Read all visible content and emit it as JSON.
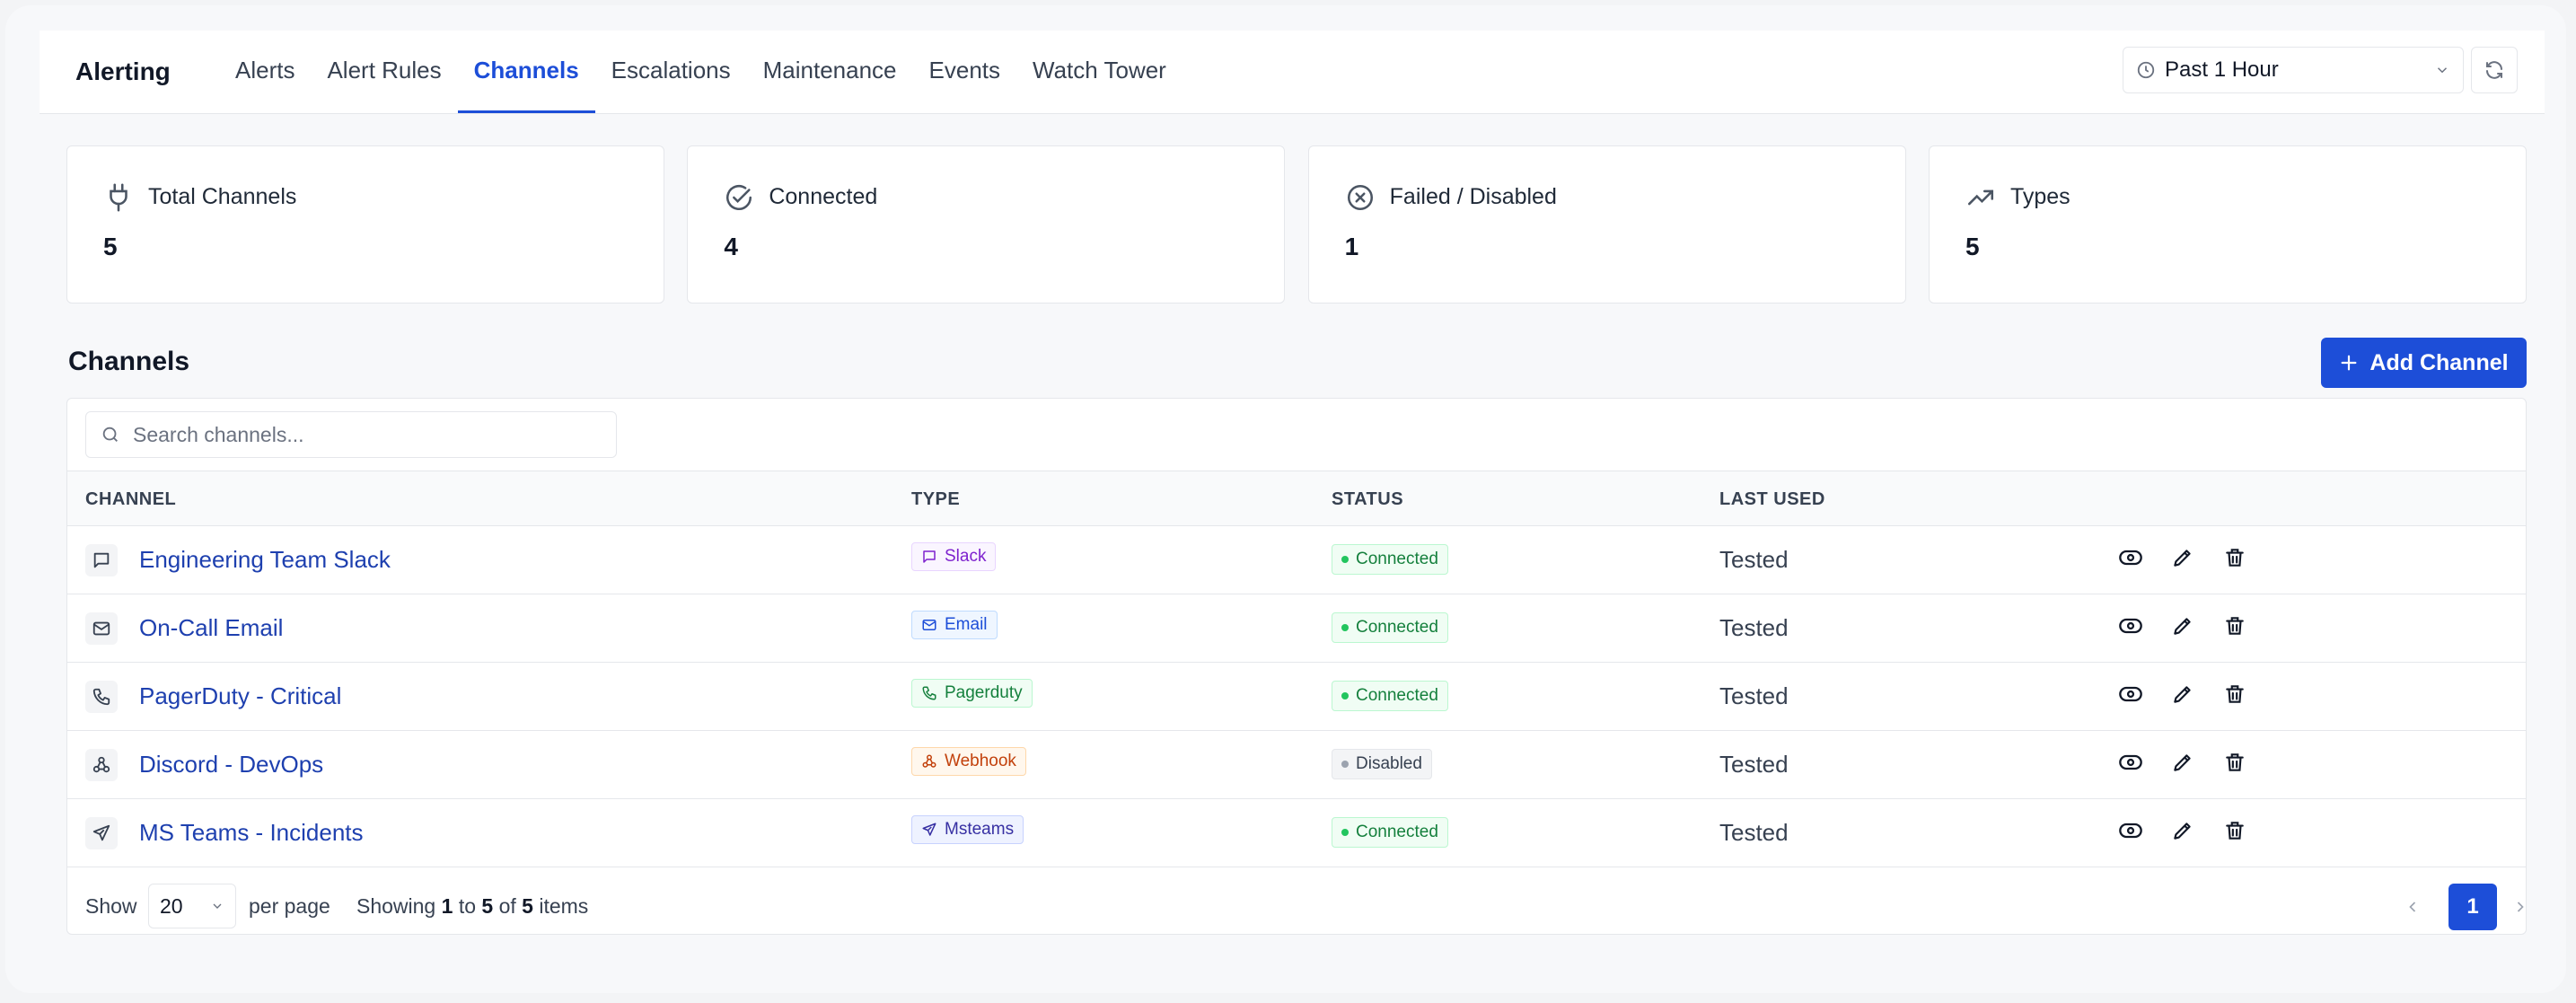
{
  "header": {
    "brand": "Alerting",
    "tabs": [
      {
        "label": "Alerts"
      },
      {
        "label": "Alert Rules"
      },
      {
        "label": "Channels",
        "active": true
      },
      {
        "label": "Escalations"
      },
      {
        "label": "Maintenance"
      },
      {
        "label": "Events"
      },
      {
        "label": "Watch Tower"
      }
    ],
    "time_range": "Past 1 Hour"
  },
  "stats": [
    {
      "label": "Total Channels",
      "value": "5",
      "icon": "plug-icon"
    },
    {
      "label": "Connected",
      "value": "4",
      "icon": "check-circle-icon"
    },
    {
      "label": "Failed / Disabled",
      "value": "1",
      "icon": "x-circle-icon"
    },
    {
      "label": "Types",
      "value": "5",
      "icon": "trending-up-icon"
    }
  ],
  "channels": {
    "title": "Channels",
    "add_label": "Add Channel",
    "search_placeholder": "Search channels...",
    "columns": [
      "CHANNEL",
      "TYPE",
      "STATUS",
      "LAST USED"
    ],
    "rows": [
      {
        "name": "Engineering Team Slack",
        "type": "Slack",
        "status": "Connected",
        "last_used": "Tested",
        "icon": "message-square-icon"
      },
      {
        "name": "On-Call Email",
        "type": "Email",
        "status": "Connected",
        "last_used": "Tested",
        "icon": "mail-icon"
      },
      {
        "name": "PagerDuty - Critical",
        "type": "Pagerduty",
        "status": "Connected",
        "last_used": "Tested",
        "icon": "phone-icon"
      },
      {
        "name": "Discord - DevOps",
        "type": "Webhook",
        "status": "Disabled",
        "last_used": "Tested",
        "icon": "webhook-icon"
      },
      {
        "name": "MS Teams - Incidents",
        "type": "Msteams",
        "status": "Connected",
        "last_used": "Tested",
        "icon": "send-icon"
      }
    ],
    "colors": {
      "Slack": {
        "fg": "#7e22ce",
        "bg": "#faf5ff",
        "border": "#e9d5ff"
      },
      "Email": {
        "fg": "#1d4ed8",
        "bg": "#eff6ff",
        "border": "#bfdbfe"
      },
      "Pagerduty": {
        "fg": "#15803d",
        "bg": "#f0fdf4",
        "border": "#bbf7d0"
      },
      "Webhook": {
        "fg": "#c2410c",
        "bg": "#fff7ed",
        "border": "#fed7aa"
      },
      "Msteams": {
        "fg": "#3730a3",
        "bg": "#eef2ff",
        "border": "#c7d2fe"
      },
      "Connected": {
        "fg": "#15803d",
        "bg": "#f0fdf4",
        "border": "#bbf7d0",
        "dot": "#22c55e"
      },
      "Disabled": {
        "fg": "#374151",
        "bg": "#f3f4f6",
        "border": "#e5e7eb",
        "dot": "#9ca3af"
      }
    }
  },
  "pagination": {
    "show_label": "Show",
    "per_page_value": "20",
    "per_page_label": "per page",
    "showing_prefix": "Showing",
    "from": "1",
    "to_word": "to",
    "to": "5",
    "of_word": "of",
    "total": "5",
    "items_word": "items",
    "current_page": "1"
  }
}
